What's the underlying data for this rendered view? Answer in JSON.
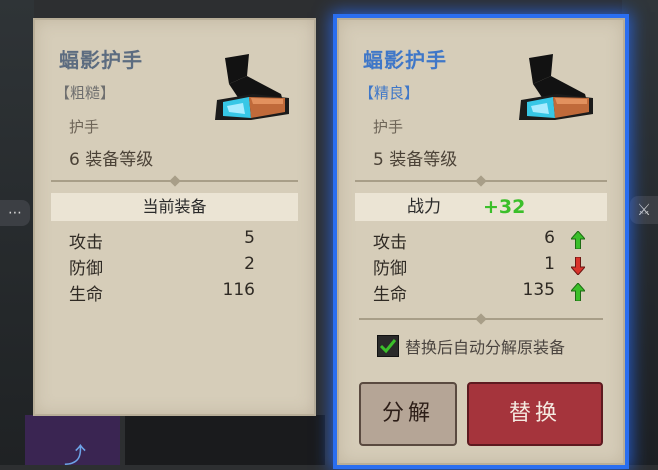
{
  "current_item": {
    "name": "蝠影护手",
    "quality": "【粗糙】",
    "type": "护手",
    "level": "6 装备等级",
    "banner": "当前装备",
    "stats": [
      {
        "label": "攻击",
        "value": "5"
      },
      {
        "label": "防御",
        "value": "2"
      },
      {
        "label": "生命",
        "value": "116"
      }
    ]
  },
  "new_item": {
    "name": "蝠影护手",
    "quality": "【精良】",
    "type": "护手",
    "level": "5 装备等级",
    "power_label": "战力",
    "power_delta": "+32",
    "stats": [
      {
        "label": "攻击",
        "value": "6",
        "trend": "up"
      },
      {
        "label": "防御",
        "value": "1",
        "trend": "down"
      },
      {
        "label": "生命",
        "value": "135",
        "trend": "up"
      }
    ],
    "auto_decompose_label": "替换后自动分解原装备",
    "auto_decompose_checked": true,
    "decompose_button": "分解",
    "replace_button": "替换"
  },
  "colors": {
    "accent_blue": "#2a6ef0",
    "gain_green": "#3bbf2a",
    "loss_red": "#d9332b",
    "replace_red": "#a5343c"
  }
}
